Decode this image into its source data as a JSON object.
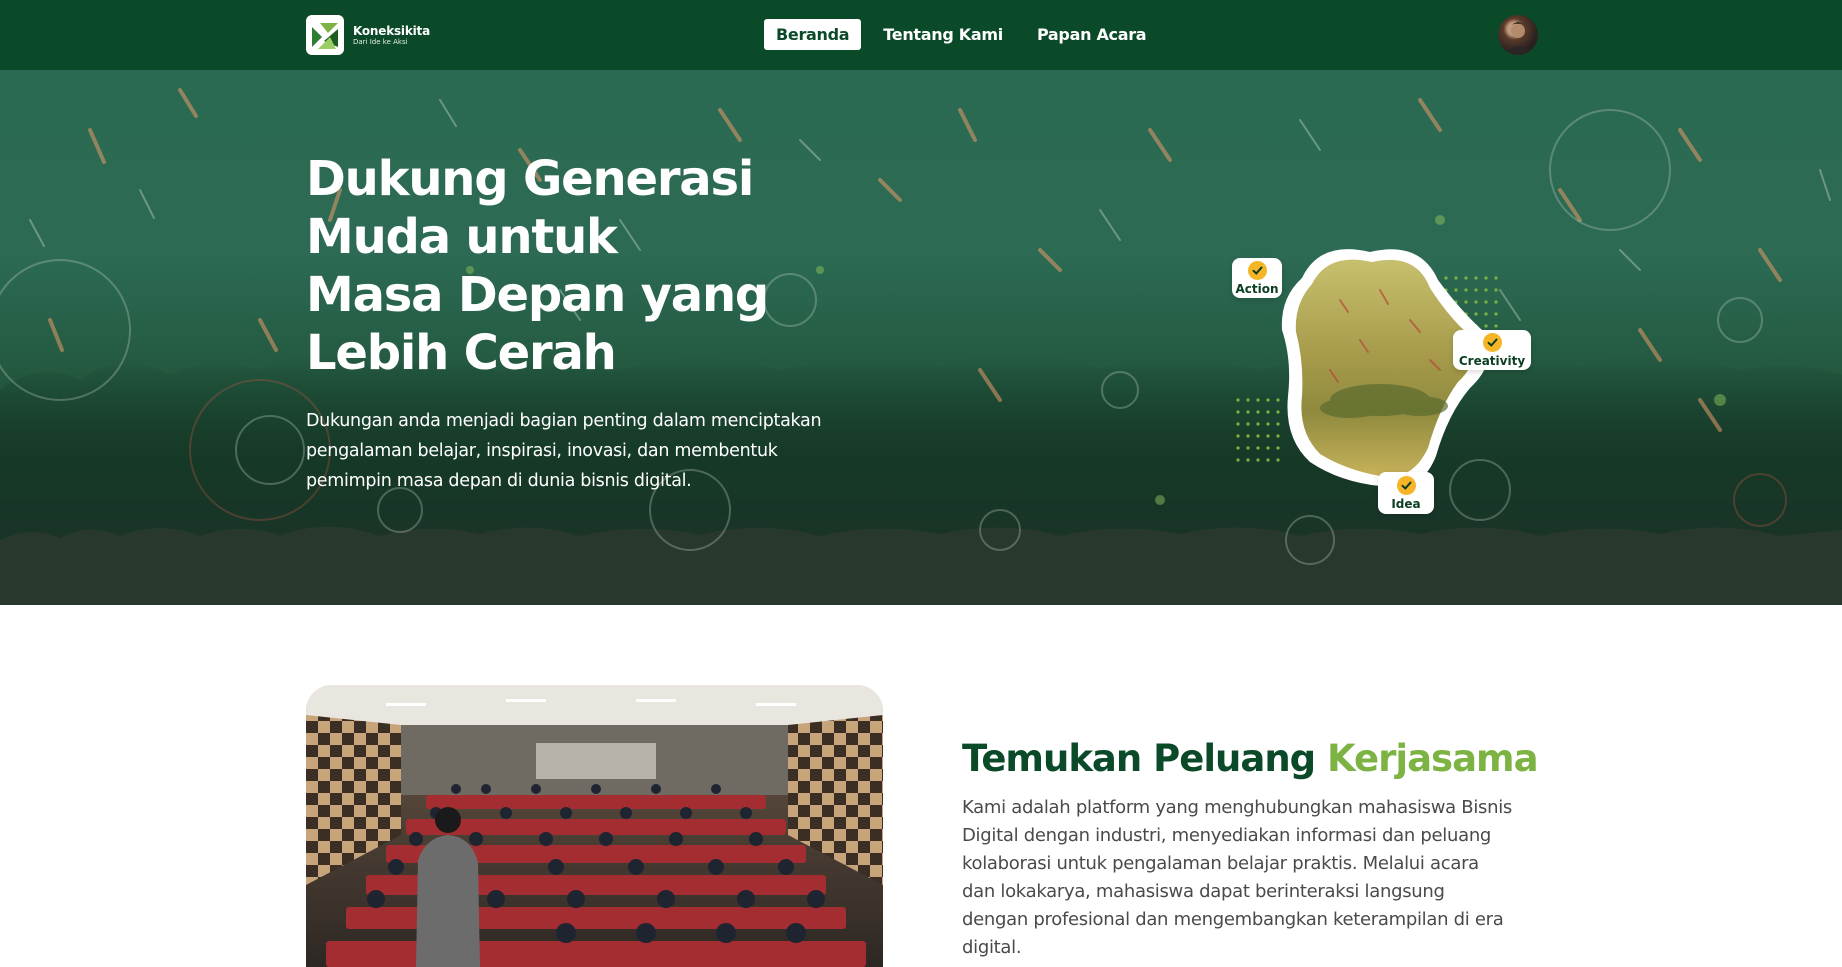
{
  "brand": {
    "name": "Koneksikita",
    "tagline": "Dari Ide ke Aksi"
  },
  "nav": {
    "items": [
      {
        "label": "Beranda",
        "active": true
      },
      {
        "label": "Tentang Kami",
        "active": false
      },
      {
        "label": "Papan Acara",
        "active": false
      }
    ]
  },
  "hero": {
    "title_lines": [
      "Dukung Generasi",
      "Muda untuk",
      "Masa Depan yang",
      "Lebih Cerah"
    ],
    "description_lines": [
      "Dukungan anda menjadi bagian penting dalam menciptakan",
      "pengalaman belajar, inspirasi, inovasi, dan membentuk",
      "pemimpin masa depan di dunia bisnis digital."
    ],
    "chips": [
      "Action",
      "Creativity",
      "Idea"
    ]
  },
  "feature": {
    "title_part1": "Temukan Peluang",
    "title_part2": "Kerjasama",
    "description_lines": [
      "Kami adalah platform yang menghubungkan mahasiswa Bisnis",
      "Digital dengan industri, menyediakan informasi dan peluang",
      "kolaborasi untuk pengalaman belajar praktis. Melalui acara",
      "dan lokakarya, mahasiswa dapat berinteraksi langsung",
      "dengan profesional dan mengembangkan keterampilan di era",
      "digital."
    ]
  },
  "colors": {
    "primary": "#0b4a29",
    "accent": "#7cb342",
    "check": "#f5b526"
  },
  "icons": {
    "logo": "koneksikita-logo-icon",
    "check": "check-circle-icon",
    "avatar": "user-avatar"
  }
}
